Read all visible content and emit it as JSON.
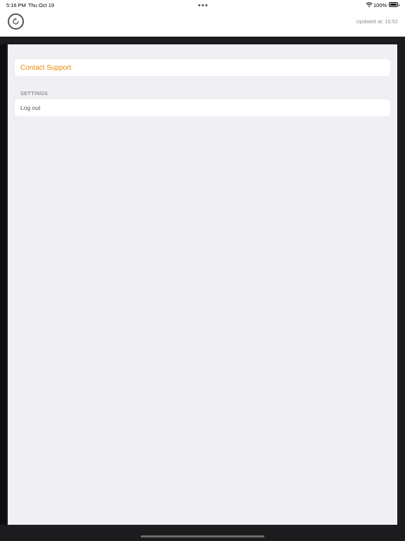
{
  "status_bar": {
    "time": "5:16 PM",
    "date": "Thu Oct 19",
    "battery_percent": "100%"
  },
  "header": {
    "updated_text": "Updated at: 15:52"
  },
  "content": {
    "contact_support_label": "Contact Support",
    "settings_section_header": "SETTINGS",
    "logout_label": "Log out"
  },
  "colors": {
    "accent": "#e88a00",
    "background": "#efeff4",
    "frame": "#1c1c1e"
  },
  "icons": {
    "refresh": "refresh-icon",
    "wifi": "wifi-icon",
    "battery": "battery-icon"
  }
}
